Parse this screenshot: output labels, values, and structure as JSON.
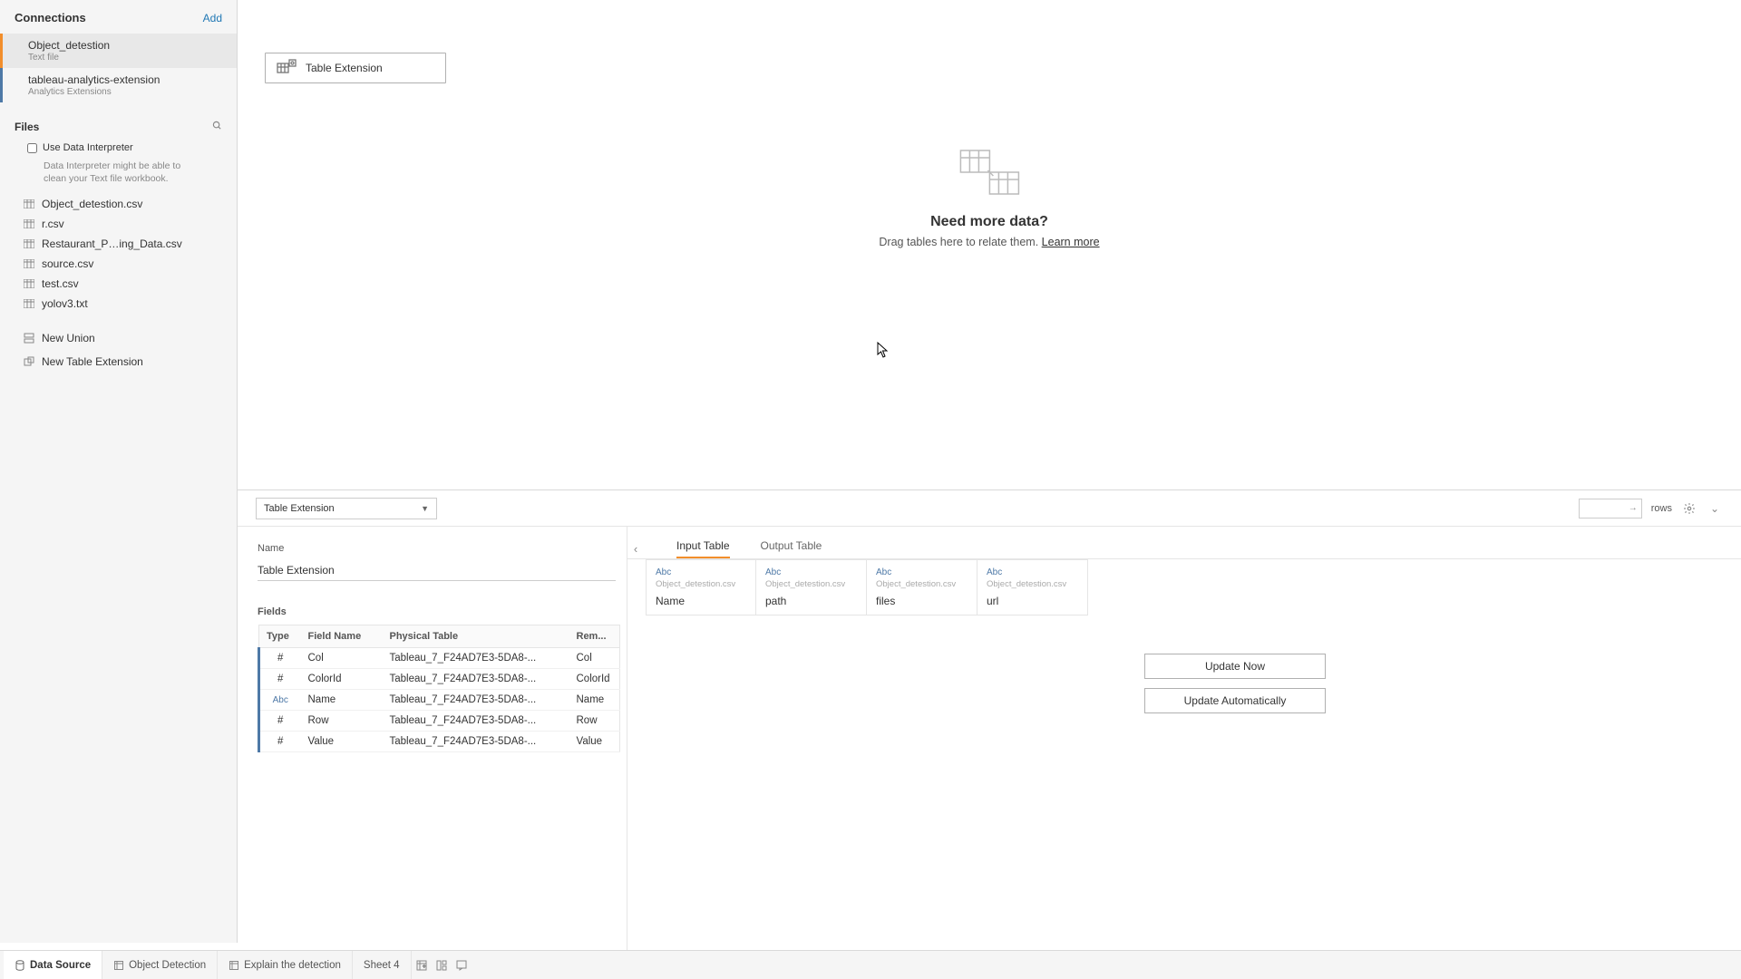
{
  "sidebar": {
    "connections_title": "Connections",
    "add_label": "Add",
    "connections": [
      {
        "title": "Object_detestion",
        "sub": "Text file",
        "active": true
      },
      {
        "title": "tableau-analytics-extension",
        "sub": "Analytics Extensions",
        "active": false
      }
    ],
    "files_title": "Files",
    "interpreter_label": "Use Data Interpreter",
    "interpreter_desc": "Data Interpreter might be able to clean your Text file workbook.",
    "files": [
      "Object_detestion.csv",
      "r.csv",
      "Restaurant_P…ing_Data.csv",
      "source.csv",
      "test.csv",
      "yolov3.txt"
    ],
    "new_union": "New Union",
    "new_table_extension": "New Table Extension"
  },
  "canvas": {
    "pill_label": "Table Extension",
    "need_more": "Need more data?",
    "drag_hint": "Drag tables here to relate them. ",
    "learn_more": "Learn more"
  },
  "lower": {
    "selector": "Table Extension",
    "rows_label": "rows",
    "name_label": "Name",
    "name_value": "Table Extension",
    "fields_label": "Fields",
    "fields_headers": {
      "type": "Type",
      "field_name": "Field Name",
      "physical": "Physical Table",
      "remote": "Rem..."
    },
    "fields_rows": [
      {
        "type": "#",
        "field_name": "Col",
        "physical": "Tableau_7_F24AD7E3-5DA8-...",
        "remote": "Col"
      },
      {
        "type": "#",
        "field_name": "ColorId",
        "physical": "Tableau_7_F24AD7E3-5DA8-...",
        "remote": "ColorId"
      },
      {
        "type": "Abc",
        "field_name": "Name",
        "physical": "Tableau_7_F24AD7E3-5DA8-...",
        "remote": "Name"
      },
      {
        "type": "#",
        "field_name": "Row",
        "physical": "Tableau_7_F24AD7E3-5DA8-...",
        "remote": "Row"
      },
      {
        "type": "#",
        "field_name": "Value",
        "physical": "Tableau_7_F24AD7E3-5DA8-...",
        "remote": "Value"
      }
    ],
    "io_tabs": {
      "input": "Input Table",
      "output": "Output Table"
    },
    "grid_cols": [
      {
        "type": "Abc",
        "src": "Object_detestion.csv",
        "name": "Name"
      },
      {
        "type": "Abc",
        "src": "Object_detestion.csv",
        "name": "path"
      },
      {
        "type": "Abc",
        "src": "Object_detestion.csv",
        "name": "files"
      },
      {
        "type": "Abc",
        "src": "Object_detestion.csv",
        "name": "url"
      }
    ],
    "update_now": "Update Now",
    "update_auto": "Update Automatically"
  },
  "bottom": {
    "data_source": "Data Source",
    "tabs": [
      "Object Detection",
      "Explain the detection",
      "Sheet 4"
    ]
  }
}
